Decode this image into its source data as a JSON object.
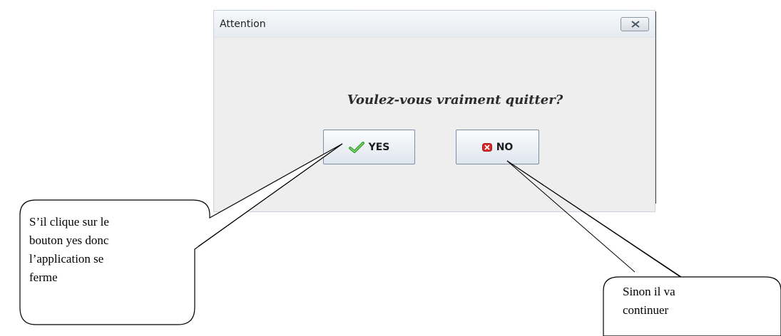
{
  "dialog": {
    "title": "Attention",
    "close_icon": "close-icon",
    "message": "Voulez-vous vraiment quitter?",
    "yes_button": {
      "label": "YES",
      "icon": "checkmark-icon"
    },
    "no_button": {
      "label": "NO",
      "icon": "red-x-icon"
    }
  },
  "callouts": {
    "left": {
      "lines": [
        "S’il clique sur le",
        "bouton yes donc",
        "l’application se",
        "ferme"
      ]
    },
    "right": {
      "lines": [
        "Sinon il va",
        "continuer"
      ]
    }
  },
  "colors": {
    "title_bar": "#eef2f6",
    "dialog_bg": "#eeeeee",
    "button_border": "#7a8ea6",
    "check_green": "#2f9e2f",
    "x_red": "#d42a2a"
  }
}
